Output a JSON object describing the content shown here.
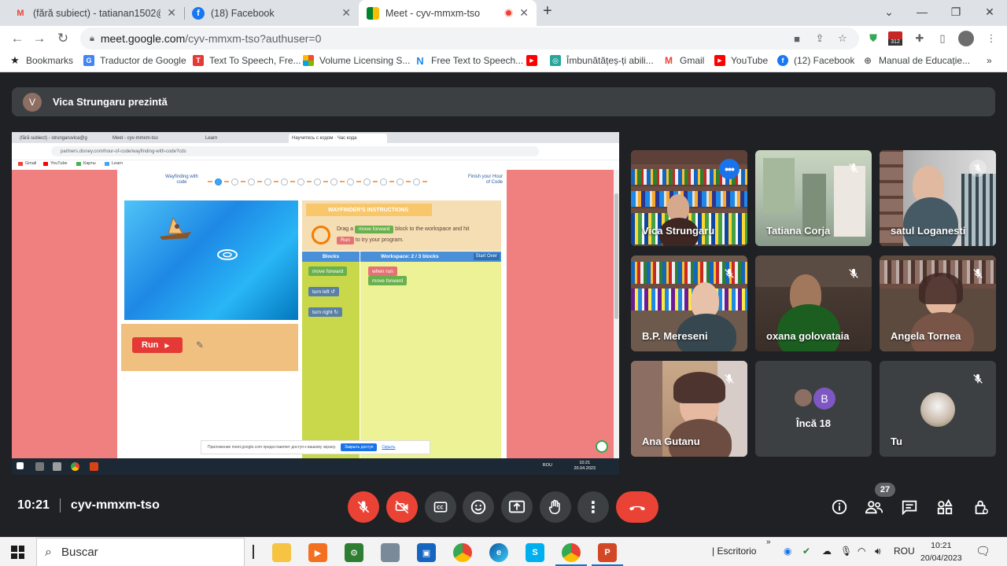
{
  "browser": {
    "tabs": [
      {
        "label": "(fără subiect) - tatianan1502@gm",
        "icon": "gmail-icon"
      },
      {
        "label": "(18) Facebook",
        "icon": "facebook-icon"
      },
      {
        "label": "Meet - cyv-mmxm-tso",
        "icon": "meet-icon"
      }
    ],
    "url_main": "meet.google.com",
    "url_rest": "/cyv-mmxm-tso?authuser=0",
    "ext_badge": "312",
    "bookmarks": [
      {
        "label": "Bookmarks",
        "icon": "star-icon"
      },
      {
        "label": "Traductor de Google",
        "icon": "google-translate-icon"
      },
      {
        "label": "Text To Speech, Fre...",
        "icon": "tts-icon"
      },
      {
        "label": "Volume Licensing S...",
        "icon": "microsoft-icon"
      },
      {
        "label": "Free Text to Speech...",
        "icon": "n-icon"
      },
      {
        "label": "",
        "icon": "youtube-icon"
      },
      {
        "label": "Îmbunătățeș-ți abili...",
        "icon": "skill-icon"
      },
      {
        "label": "Gmail",
        "icon": "gmail-icon"
      },
      {
        "label": "YouTube",
        "icon": "youtube-icon"
      },
      {
        "label": "(12) Facebook",
        "icon": "facebook-icon"
      },
      {
        "label": "Manual de Educație...",
        "icon": "globe-icon"
      }
    ]
  },
  "meet": {
    "presenter_initial": "V",
    "presenter_text": "Vica Strungaru prezintă",
    "time": "10:21",
    "meeting_code": "cyv-mmxm-tso",
    "participants_count": "27",
    "participants": [
      {
        "name": "Vica Strungaru",
        "speaking": true
      },
      {
        "name": "Tatiana Corja"
      },
      {
        "name": "satul Loganesti"
      },
      {
        "name": "B.P. Mereseni"
      },
      {
        "name": "oxana golovataia"
      },
      {
        "name": "Angela Tornea"
      },
      {
        "name": "Ana Gutanu"
      },
      {
        "name": "Încă 18",
        "avatar_letter": "B"
      },
      {
        "name": "Tu"
      }
    ]
  },
  "shared_screen": {
    "tabs": [
      "(fără subiect) - strungaruvica@g",
      "Meet - cyv-mmxm-tso",
      "Learn",
      "Научитесь с кодом · Час кода"
    ],
    "url": "partners.disney.com/hour-of-code/wayfinding-with-code?cds",
    "bookmarks": [
      "Gmail",
      "YouTube",
      "Карты",
      "Learn"
    ],
    "page_title": "Wayfinding with code",
    "finish_text": "Finish your Hour of Code",
    "progress_current": "1",
    "instructions_title": "WAYFINDER'S INSTRUCTIONS",
    "instr_drag": "Drag a",
    "instr_block": "move forward",
    "instr_after": "block to the workspace and hit",
    "instr_run": "Run",
    "instr_end": "to try your program.",
    "blocks_header": "Blocks",
    "workspace_header": "Workspace: 2 / 3 blocks",
    "start_over": "Start Over",
    "palette": [
      "move forward",
      "turn left ↺",
      "turn right ↻"
    ],
    "workspace_blocks": [
      "when run",
      "move forward"
    ],
    "run_label": "Run",
    "notice_text": "Приложение meet.google.com предоставляет доступ к вашему экрану.",
    "notice_button": "Закрыть доступ",
    "notice_link": "Скрыть",
    "tray_lang": "ROU",
    "clock_time": "10:21",
    "clock_date": "20.04.2023"
  },
  "taskbar": {
    "search_placeholder": "Buscar",
    "desktop_label": "Escritorio",
    "lang": "ROU",
    "time": "10:21",
    "date": "20/04/2023"
  }
}
